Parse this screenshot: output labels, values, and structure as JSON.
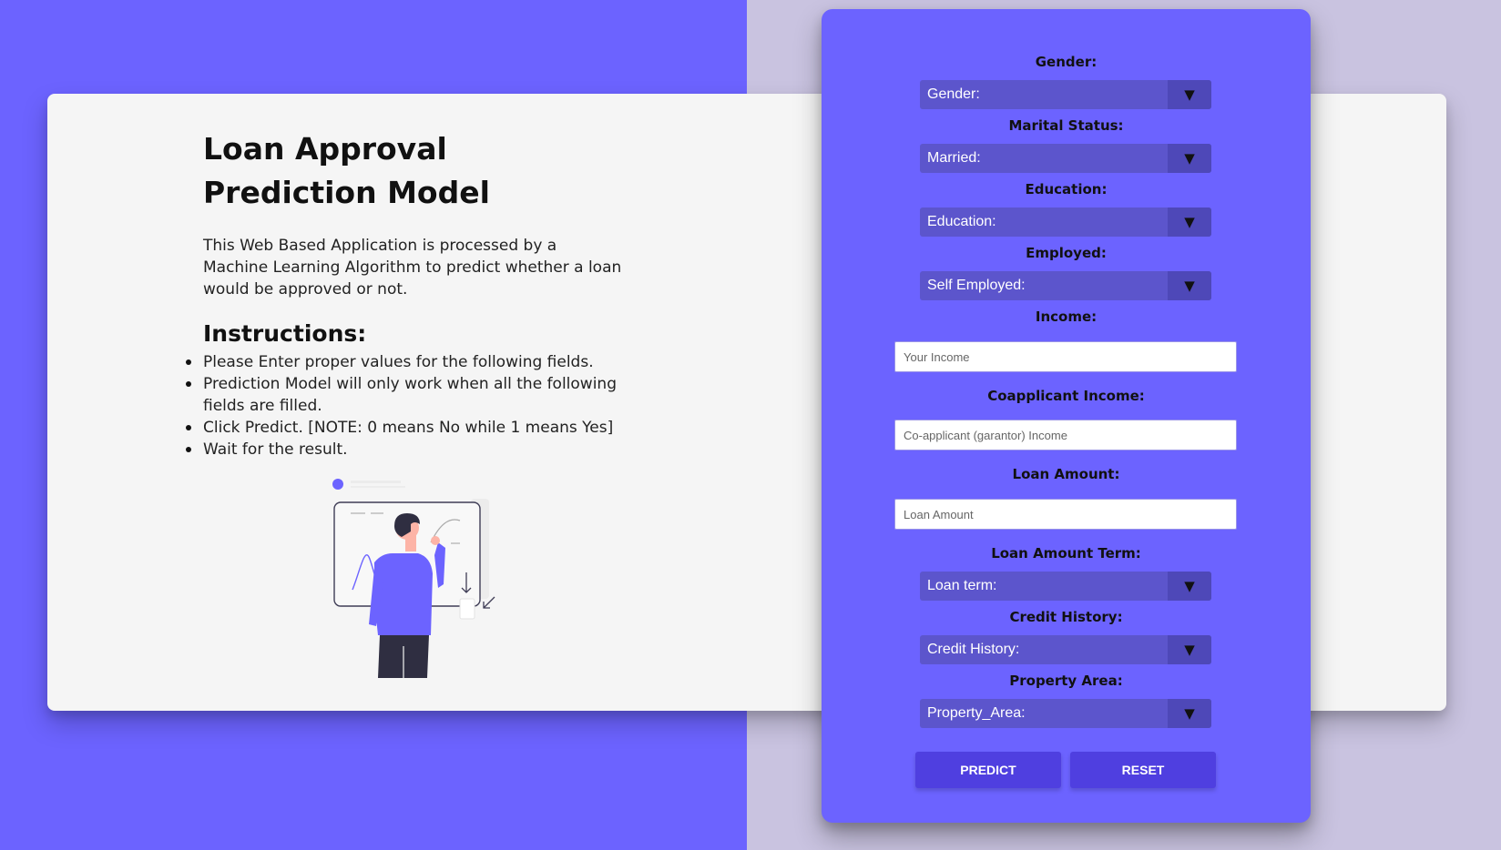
{
  "intro": {
    "title": "Loan Approval Prediction Model",
    "description": "This Web Based Application is processed by a Machine Learning Algorithm to predict whether a loan would be approved or not.",
    "instructions_heading": "Instructions:",
    "instructions": [
      "Please Enter proper values for the following fields.",
      "Prediction Model will only work when all the following fields are filled.",
      "Click Predict. [NOTE: 0 means No while 1 means Yes]",
      "Wait for the result."
    ]
  },
  "form": {
    "gender": {
      "label": "Gender:",
      "value": "Gender:"
    },
    "marital": {
      "label": "Marital Status:",
      "value": "Married:"
    },
    "education": {
      "label": "Education:",
      "value": "Education:"
    },
    "employed": {
      "label": "Employed:",
      "value": "Self Employed:"
    },
    "income": {
      "label": "Income:",
      "placeholder": "Your Income"
    },
    "coapplicant": {
      "label": "Coapplicant Income:",
      "placeholder": "Co-applicant (garantor) Income"
    },
    "loan_amount": {
      "label": "Loan Amount:",
      "placeholder": "Loan Amount"
    },
    "loan_term": {
      "label": "Loan Amount Term:",
      "value": "Loan term:"
    },
    "credit_history": {
      "label": "Credit History:",
      "value": "Credit History:"
    },
    "property_area": {
      "label": "Property Area:",
      "value": "Property_Area:"
    },
    "arrow": "▼",
    "predict_label": "PREDICT",
    "reset_label": "RESET"
  },
  "colors": {
    "accent": "#6c63ff",
    "panel_bg": "#6c63ff",
    "select_bg": "#5c55cc",
    "button_bg": "#4f3fe0",
    "right_bg": "#c9c3e0",
    "card_bg": "#f5f5f5"
  }
}
